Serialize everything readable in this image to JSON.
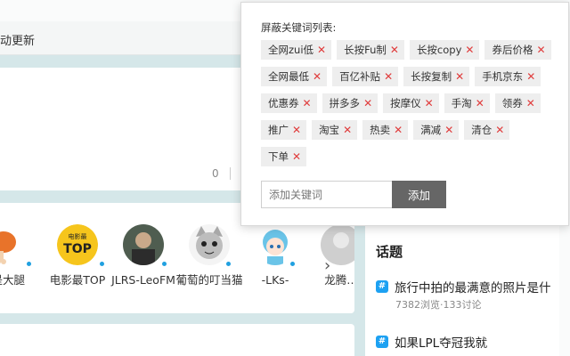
{
  "background": {
    "update_text": "动更新",
    "count": "0"
  },
  "users": [
    {
      "name": "…是大腿",
      "avatar": "drumstick-avatar",
      "color": "#e8732a"
    },
    {
      "name": "电影最TOP",
      "avatar": "top-logo-avatar",
      "color": "#f6c51c"
    },
    {
      "name": "JLRS-LeoFM",
      "avatar": "photo-avatar",
      "color": "#556655"
    },
    {
      "name": "葡萄的叮当猫",
      "avatar": "cat-avatar",
      "color": "#b0b0b0"
    },
    {
      "name": "-LKs-",
      "avatar": "anime-girl-avatar",
      "color": "#6ac4e8"
    },
    {
      "name": "龙腾…",
      "avatar": "partial-avatar",
      "color": "#cfcfcf"
    }
  ],
  "topics": {
    "title": "话题",
    "items": [
      {
        "name": "旅行中拍的最满意的照片是什",
        "meta": "7382浏览·133讨论"
      },
      {
        "name": "如果LPL夺冠我就",
        "meta": ""
      }
    ]
  },
  "popup": {
    "title": "屏蔽关键词列表:",
    "tags": [
      "全网zui低",
      "长按Fu制",
      "长按copy",
      "券后价格",
      "全网最低",
      "百亿补贴",
      "长按复制",
      "手机京东",
      "优惠券",
      "拼多多",
      "按摩仪",
      "手淘",
      "领券",
      "推广",
      "淘宝",
      "热卖",
      "满减",
      "清仓",
      "下单"
    ],
    "input_placeholder": "添加关键词",
    "add_label": "添加"
  },
  "colors": {
    "page_bg": "#d5e7e9",
    "tag_bg": "#eeeeee",
    "remove_x": "#e03c3c",
    "add_button": "#666666",
    "hash_badge": "#1da1f2"
  }
}
